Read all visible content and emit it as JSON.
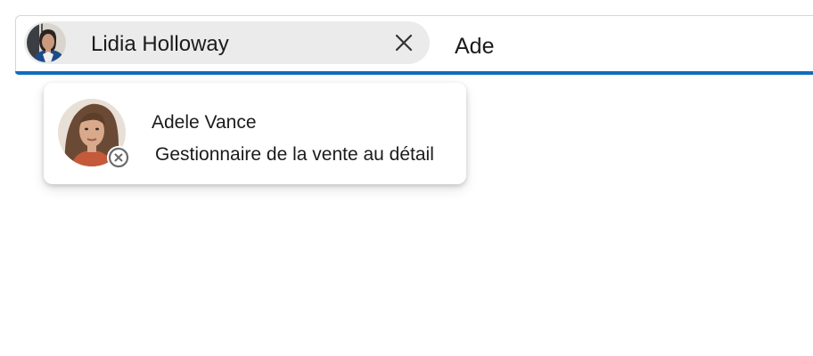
{
  "picker": {
    "selected_person": {
      "name": "Lidia Holloway",
      "avatar_icon": "person-avatar-icon"
    },
    "remove_icon": "close-icon",
    "query_text": "Ade",
    "accent_color": "#0f6cbd",
    "chip_background": "#ebebeb"
  },
  "suggestions": [
    {
      "name": "Adele Vance",
      "role": "Gestionnaire de la vente au détail",
      "presence": "offline",
      "presence_icon": "presence-offline-icon"
    }
  ]
}
